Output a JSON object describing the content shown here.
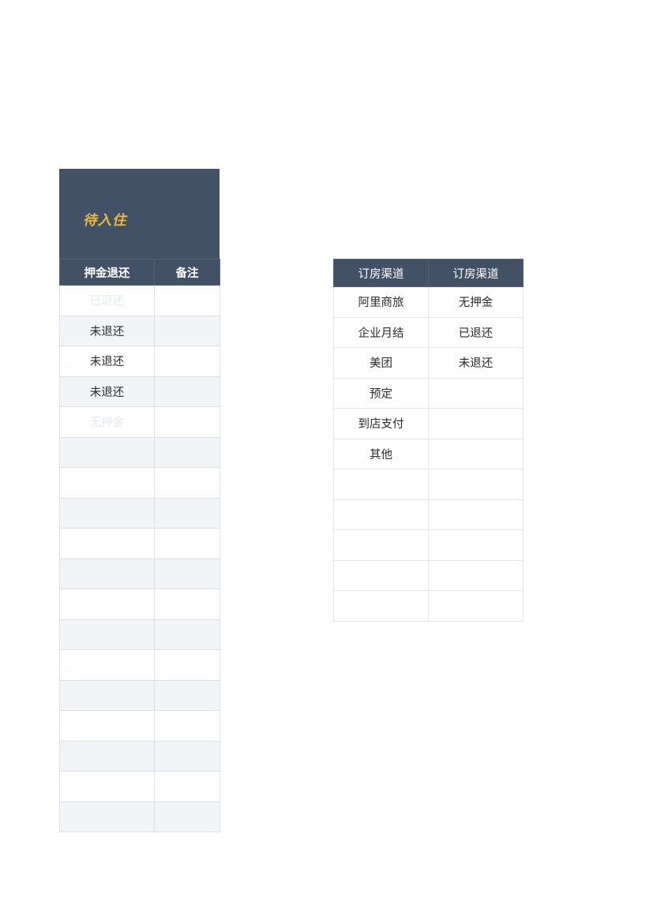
{
  "page": {
    "background_color": "#ffffff",
    "header_color": "#435167",
    "accent_color": "#e9b93e",
    "alt_row_color": "#f2f4f7",
    "muted_text_color": "#e7e9ec",
    "body_text_color": "#2b2b2b"
  },
  "left_block": {
    "banner": {
      "title": "待入住"
    },
    "table": {
      "name": "deposit-refund-table",
      "columns": [
        "押金退还",
        "备注"
      ],
      "rows": [
        {
          "cells": [
            "已退还",
            ""
          ],
          "muted": [
            true,
            false
          ]
        },
        {
          "cells": [
            "未退还",
            ""
          ],
          "muted": [
            false,
            false
          ]
        },
        {
          "cells": [
            "未退还",
            ""
          ],
          "muted": [
            false,
            false
          ]
        },
        {
          "cells": [
            "未退还",
            ""
          ],
          "muted": [
            false,
            false
          ]
        },
        {
          "cells": [
            "无押金",
            ""
          ],
          "muted": [
            true,
            false
          ]
        },
        {
          "cells": [
            "",
            ""
          ],
          "muted": [
            false,
            false
          ]
        },
        {
          "cells": [
            "",
            ""
          ],
          "muted": [
            false,
            false
          ]
        },
        {
          "cells": [
            "",
            ""
          ],
          "muted": [
            false,
            false
          ]
        },
        {
          "cells": [
            "",
            ""
          ],
          "muted": [
            false,
            false
          ]
        },
        {
          "cells": [
            "",
            ""
          ],
          "muted": [
            false,
            false
          ]
        },
        {
          "cells": [
            "",
            ""
          ],
          "muted": [
            false,
            false
          ]
        },
        {
          "cells": [
            "",
            ""
          ],
          "muted": [
            false,
            false
          ]
        },
        {
          "cells": [
            "",
            ""
          ],
          "muted": [
            false,
            false
          ]
        },
        {
          "cells": [
            "",
            ""
          ],
          "muted": [
            false,
            false
          ]
        },
        {
          "cells": [
            "",
            ""
          ],
          "muted": [
            false,
            false
          ]
        },
        {
          "cells": [
            "",
            ""
          ],
          "muted": [
            false,
            false
          ]
        },
        {
          "cells": [
            "",
            ""
          ],
          "muted": [
            false,
            false
          ]
        },
        {
          "cells": [
            "",
            ""
          ],
          "muted": [
            false,
            false
          ]
        }
      ]
    }
  },
  "right_block": {
    "table": {
      "name": "booking-channel-table",
      "columns": [
        "订房渠道",
        "订房渠道"
      ],
      "rows": [
        {
          "cells": [
            "阿里商旅",
            "无押金"
          ]
        },
        {
          "cells": [
            "企业月结",
            "已退还"
          ]
        },
        {
          "cells": [
            "美团",
            "未退还"
          ]
        },
        {
          "cells": [
            "预定",
            ""
          ]
        },
        {
          "cells": [
            "到店支付",
            ""
          ]
        },
        {
          "cells": [
            "其他",
            ""
          ]
        },
        {
          "cells": [
            "",
            ""
          ]
        },
        {
          "cells": [
            "",
            ""
          ]
        },
        {
          "cells": [
            "",
            ""
          ]
        },
        {
          "cells": [
            "",
            ""
          ]
        },
        {
          "cells": [
            "",
            ""
          ]
        }
      ]
    }
  }
}
